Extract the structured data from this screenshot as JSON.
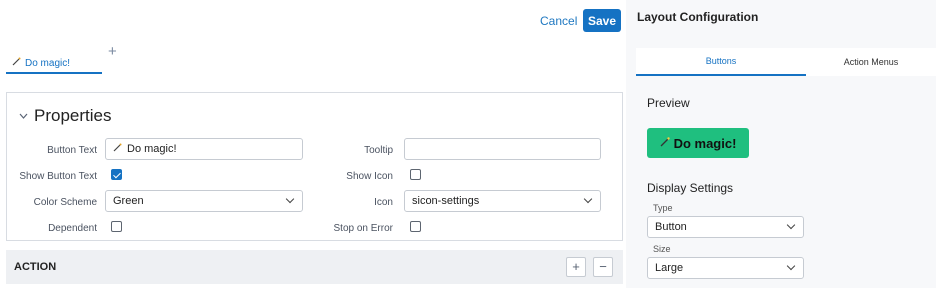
{
  "header": {
    "cancel_label": "Cancel",
    "save_label": "Save"
  },
  "tabs": {
    "button_tab_label": "Do magic!",
    "button_tab_icon": "wand-icon",
    "add_tab_label": "+"
  },
  "properties": {
    "title": "Properties",
    "button_text_label": "Button Text",
    "button_text_value": "Do magic!",
    "tooltip_label": "Tooltip",
    "tooltip_value": "",
    "show_button_text_label": "Show Button Text",
    "show_button_text_checked": true,
    "show_icon_label": "Show Icon",
    "show_icon_checked": false,
    "color_scheme_label": "Color Scheme",
    "color_scheme_value": "Green",
    "icon_label": "Icon",
    "icon_value": "sicon-settings",
    "dependent_label": "Dependent",
    "dependent_checked": false,
    "stop_on_error_label": "Stop on Error",
    "stop_on_error_checked": false
  },
  "action": {
    "title": "ACTION",
    "add_label": "+",
    "remove_label": "−"
  },
  "layout": {
    "title": "Layout Configuration",
    "tabs": [
      "Buttons",
      "Action Menus"
    ],
    "active_tab": "Buttons",
    "preview_label": "Preview",
    "preview_button_label": "Do magic!",
    "preview_button_color": "#1fbf7f",
    "display_settings_label": "Display Settings",
    "type_label": "Type",
    "type_value": "Button",
    "size_label": "Size",
    "size_value": "Large"
  },
  "colors": {
    "primary": "#1572c3",
    "green": "#1fbf7f",
    "panel_bg": "#f7f8fa",
    "action_bar_bg": "#eef0f3"
  }
}
